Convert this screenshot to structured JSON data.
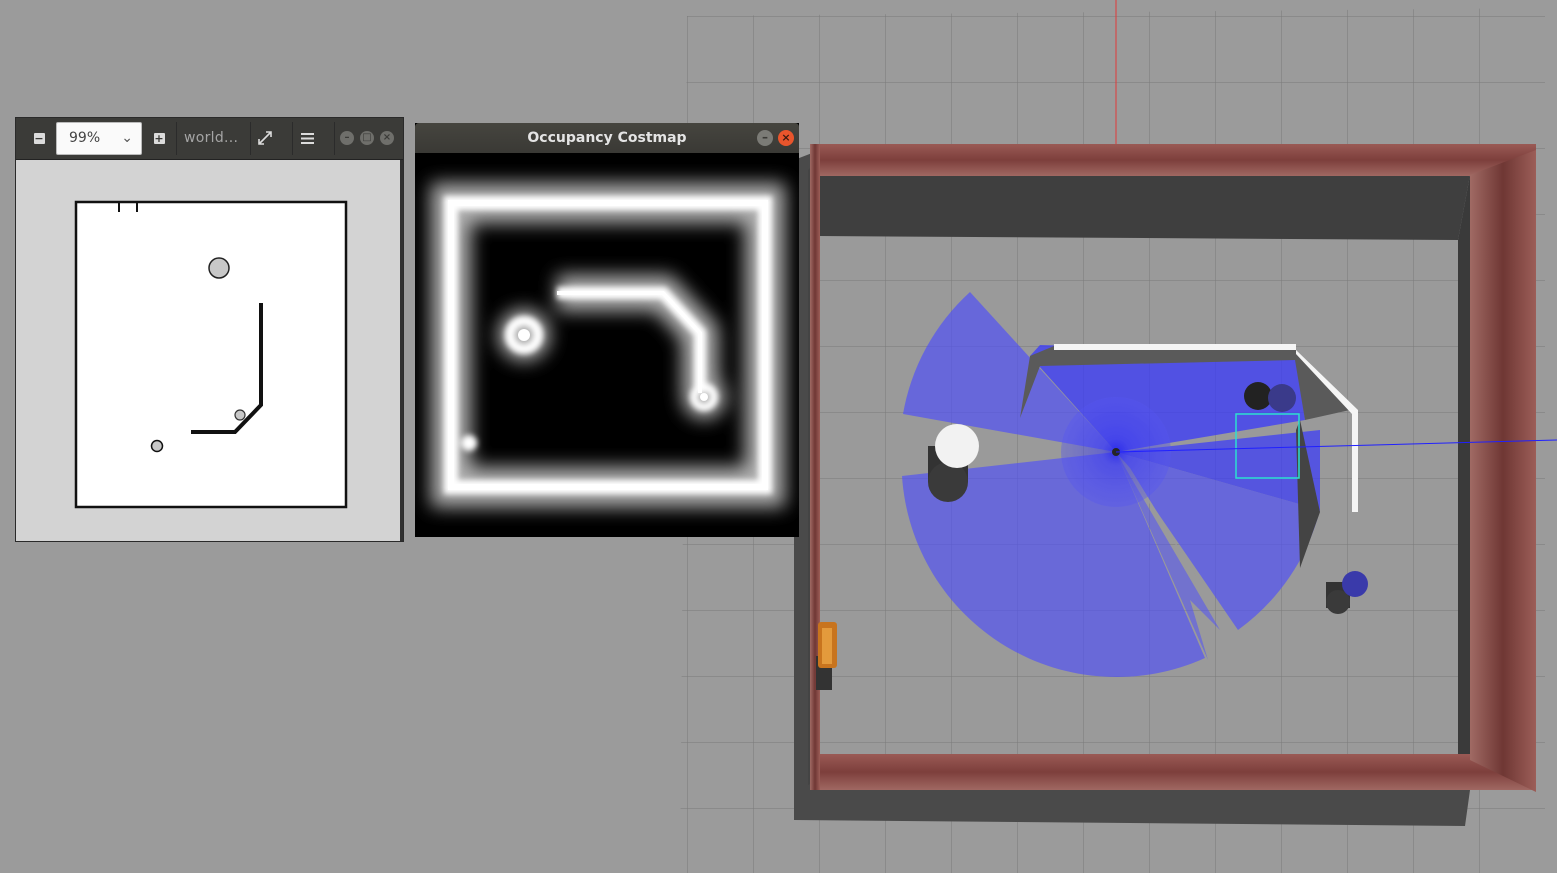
{
  "viewer": {
    "zoom_value": "99%",
    "title": "world...",
    "icons": [
      "zoom-out-icon",
      "zoom-in-icon",
      "fullscreen-icon",
      "menu-icon"
    ]
  },
  "costmap": {
    "title": "Occupancy Costmap"
  },
  "colors": {
    "desktop_bg": "#9b9b9b",
    "toolbar_bg": "#3b3b38",
    "laser_blue": "#2020ff",
    "close_button": "#e9552c",
    "wall_brick": "#8a4a45"
  }
}
